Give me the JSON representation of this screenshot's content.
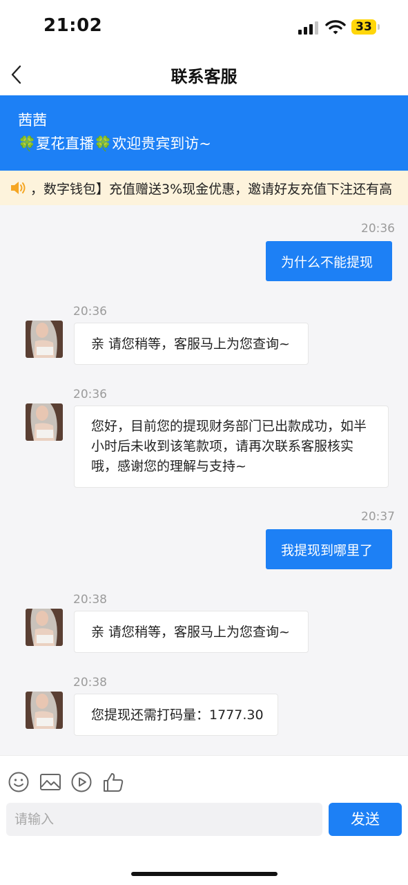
{
  "status_bar": {
    "time": "21:02",
    "battery": "33"
  },
  "header": {
    "title": "联系客服",
    "back_icon": "chevron-left-icon"
  },
  "notice": {
    "name": "茜茜",
    "welcome_prefix": "🍀",
    "welcome_mid": "夏花直播",
    "welcome_suffix": "欢迎贵宾到访~",
    "clover_icon": "clover"
  },
  "marquee": {
    "text": "，数字钱包】充值赠送3%现金优惠，邀请好友充值下注还有高",
    "icon": "speaker-icon"
  },
  "messages": [
    {
      "side": "out",
      "time": "20:36",
      "text": "为什么不能提现"
    },
    {
      "side": "in",
      "time": "20:36",
      "text": "亲 请您稍等，客服马上为您查询~"
    },
    {
      "side": "in",
      "time": "20:36",
      "text": "您好，目前您的提现财务部门已出款成功，如半小时后未收到该笔款项，请再次联系客服核实哦，感谢您的理解与支持~"
    },
    {
      "side": "out",
      "time": "20:37",
      "text": "我提现到哪里了"
    },
    {
      "side": "in",
      "time": "20:38",
      "text": "亲 请您稍等，客服马上为您查询~"
    },
    {
      "side": "in",
      "time": "20:38",
      "text": "您提现还需打码量：1777.30"
    }
  ],
  "composer": {
    "placeholder": "请输入",
    "send_label": "发送",
    "tools": [
      "emoji-icon",
      "image-icon",
      "video-icon",
      "thumbs-up-icon"
    ]
  },
  "colors": {
    "primary": "#1d80f5",
    "marquee_bg": "#fdf3dc",
    "chat_bg": "#f5f5f7"
  }
}
